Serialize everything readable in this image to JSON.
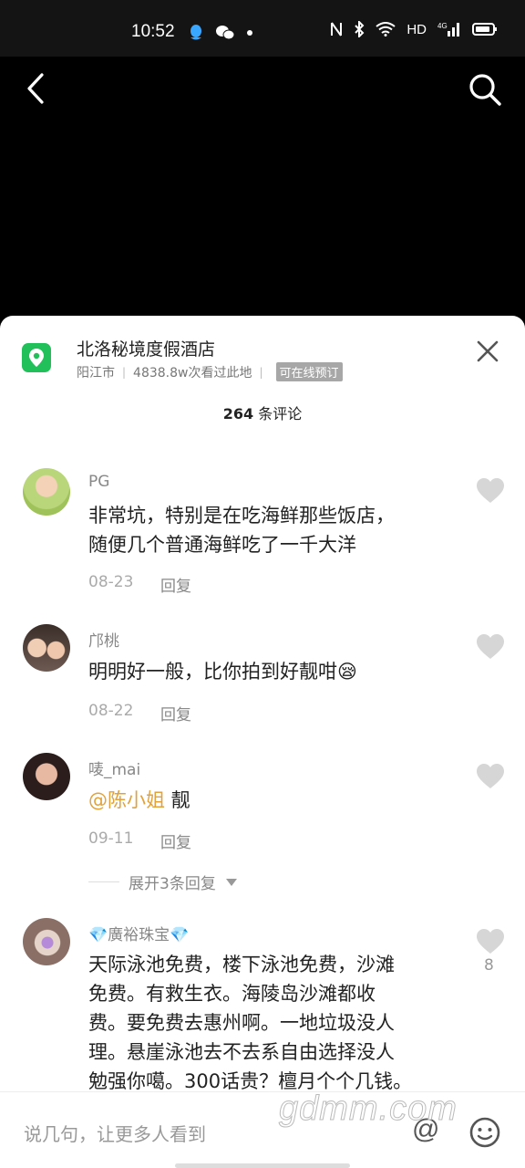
{
  "status": {
    "time": "10:52",
    "network": "HD",
    "signal_type": "4G"
  },
  "location": {
    "title": "北洛秘境度假酒店",
    "city": "阳江市",
    "visits": "4838.8w次看过此地",
    "badge": "可在线预订"
  },
  "comments_header": {
    "count": "264",
    "suffix": " 条评论"
  },
  "comments": [
    {
      "name": "PG",
      "line1": "非常坑，特别是在吃海鲜那些饭店，",
      "line2": "随便几个普通海鲜吃了一千大洋",
      "date": "08-23",
      "reply": "回复"
    },
    {
      "name": "邝桃",
      "text": "明明好一般，比你拍到好靓咁",
      "emoji": "😪",
      "date": "08-22",
      "reply": "回复"
    },
    {
      "name": "唛_mai",
      "mention": "@陈小姐",
      "text": " 靓",
      "date": "09-11",
      "reply": "回复",
      "expand": "展开3条回复"
    },
    {
      "name": "💎廣裕珠宝💎",
      "lines": [
        "天际泳池免费，楼下泳池免费，沙滩",
        "免费。有救生衣。海陵岛沙滩都收",
        "费。要免费去惠州啊。一地垃圾没人",
        "理。悬崖泳池去不去系自由选择没人",
        "勉强你噶。300话贵？檀月个个几钱。"
      ],
      "likes": "8"
    }
  ],
  "input": {
    "placeholder": "说几句，让更多人看到",
    "at": "@"
  },
  "watermark": "gdmm.com"
}
